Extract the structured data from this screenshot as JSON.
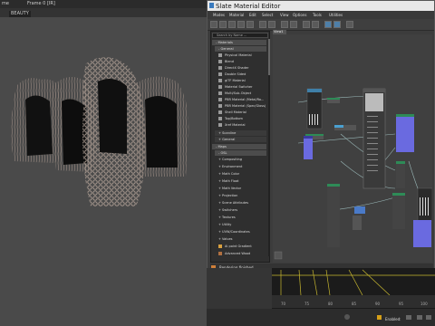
{
  "viewport": {
    "label_left": "me",
    "frame_label": "Frame 0 [IR]",
    "view_mode": "BEAUTY"
  },
  "editor": {
    "title": "Slate Material Editor",
    "menus": [
      "Modes",
      "Material",
      "Edit",
      "Select",
      "View",
      "Options",
      "Tools",
      "Utilities"
    ],
    "view_tab": "View1",
    "status": "Rendering finished"
  },
  "browser": {
    "search_placeholder": "Search by Name ...",
    "categories": {
      "materials": "- Materials",
      "general": "- General",
      "scanline": "+ Scanline",
      "general2": "+ General",
      "maps": "- Maps",
      "osl": "- OSL"
    },
    "general_items": [
      "Physical Material",
      "Blend",
      "DirectX Shader",
      "Double Sided",
      "glTF Material",
      "Material Switcher",
      "Multi/Sub-Object",
      "PBR Material (Metal/Ro...",
      "PBR Material (Spec/Gloss)",
      "Shell Material",
      "Top/Bottom",
      "Xref Material"
    ],
    "osl_items": [
      "Compositing",
      "Environment",
      "Math Color",
      "Math Float",
      "Math Vector",
      "Projection",
      "Scene Attributes",
      "Switchers",
      "Textures",
      "Utility",
      "UVW/Coordinates",
      "Values",
      "Ai point Gradient",
      "Advanced Wood"
    ]
  },
  "timeline": {
    "ticks": [
      "70",
      "75",
      "80",
      "85",
      "90",
      "95",
      "100"
    ],
    "enabled_label": "Enabled:"
  }
}
